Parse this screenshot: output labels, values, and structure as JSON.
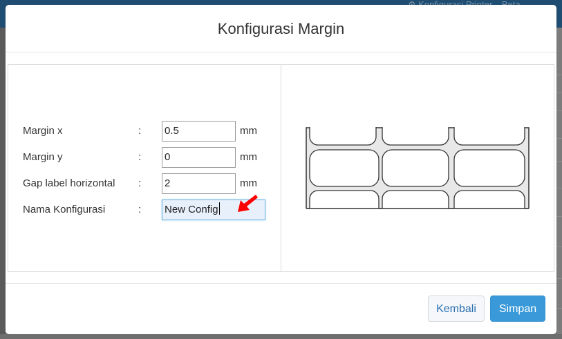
{
  "background": {
    "topbar_text": "⚙ Konfigurasi Printer",
    "topbar_text_right": "Beta"
  },
  "modal": {
    "title": "Konfigurasi Margin",
    "fields": [
      {
        "label": "Margin x",
        "colon": ":",
        "value": "0.5",
        "unit": "mm"
      },
      {
        "label": "Margin y",
        "colon": ":",
        "value": "0",
        "unit": "mm"
      },
      {
        "label": "Gap label horizontal",
        "colon": ":",
        "value": "2",
        "unit": "mm"
      },
      {
        "label": "Nama Konfigurasi",
        "colon": ":",
        "value": "New Config"
      }
    ],
    "buttons": {
      "back": "Kembali",
      "save": "Simpan"
    }
  },
  "colors": {
    "primary": "#3a9ad9",
    "header_bar": "#1f4d72",
    "focus_border": "#6fb2e0",
    "arrow": "#ff0000"
  },
  "icons": {
    "annotation": "red-arrow-icon",
    "preview": "label-sheet-icon"
  }
}
